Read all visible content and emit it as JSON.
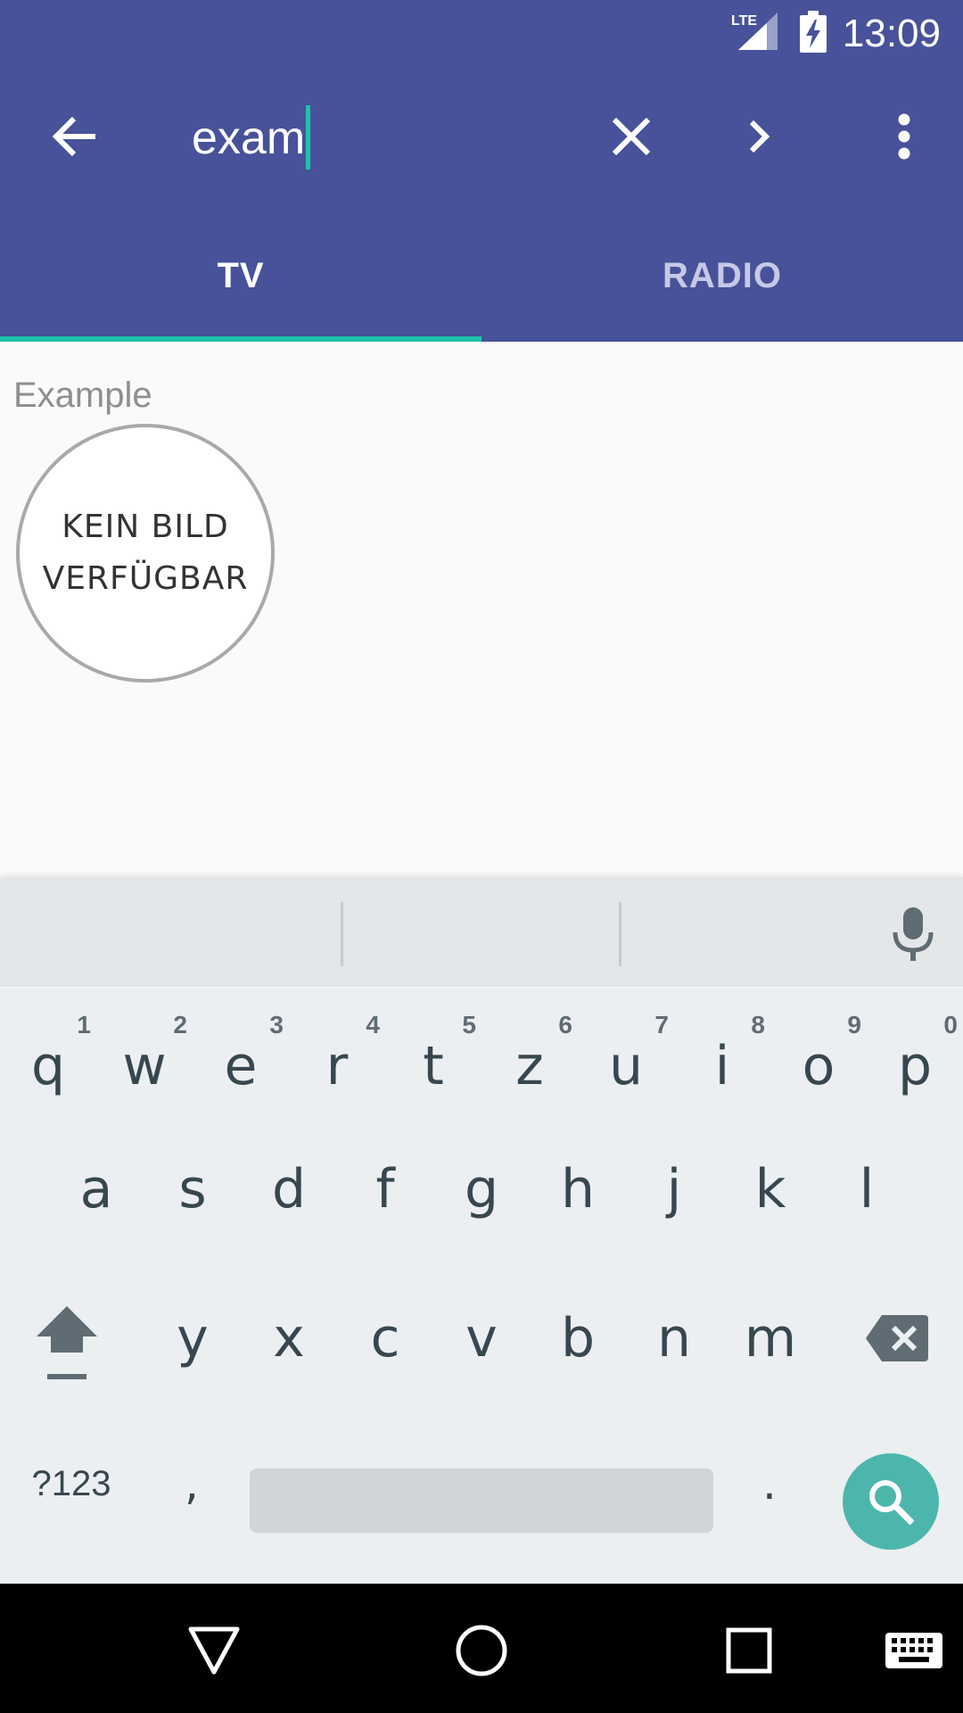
{
  "status_bar": {
    "time": "13:09",
    "network": "LTE",
    "icons": [
      "lte-signal-icon",
      "battery-charging-icon"
    ]
  },
  "toolbar": {
    "back_icon": "arrow-back-icon",
    "search_text": "exam",
    "clear_icon": "close-icon",
    "next_icon": "chevron-right-icon",
    "more_icon": "more-vert-icon"
  },
  "tabs": [
    {
      "label": "TV",
      "selected": true
    },
    {
      "label": "RADIO",
      "selected": false
    }
  ],
  "results": {
    "title": "Example",
    "placeholder_line1": "KEIN BILD",
    "placeholder_line2": "VERFÜGBAR"
  },
  "keyboard": {
    "row1": [
      {
        "key": "q",
        "hint": "1"
      },
      {
        "key": "w",
        "hint": "2"
      },
      {
        "key": "e",
        "hint": "3"
      },
      {
        "key": "r",
        "hint": "4"
      },
      {
        "key": "t",
        "hint": "5"
      },
      {
        "key": "z",
        "hint": "6"
      },
      {
        "key": "u",
        "hint": "7"
      },
      {
        "key": "i",
        "hint": "8"
      },
      {
        "key": "o",
        "hint": "9"
      },
      {
        "key": "p",
        "hint": "0"
      }
    ],
    "row2": [
      "a",
      "s",
      "d",
      "f",
      "g",
      "h",
      "j",
      "k",
      "l"
    ],
    "row3": [
      "y",
      "x",
      "c",
      "v",
      "b",
      "n",
      "m"
    ],
    "symbols_key": "?123",
    "comma_key": ",",
    "period_key": ".",
    "action_icon": "search-icon",
    "accent_color": "#4db6ac"
  },
  "colors": {
    "primary": "#47529a",
    "accent": "#1ec3a8"
  }
}
